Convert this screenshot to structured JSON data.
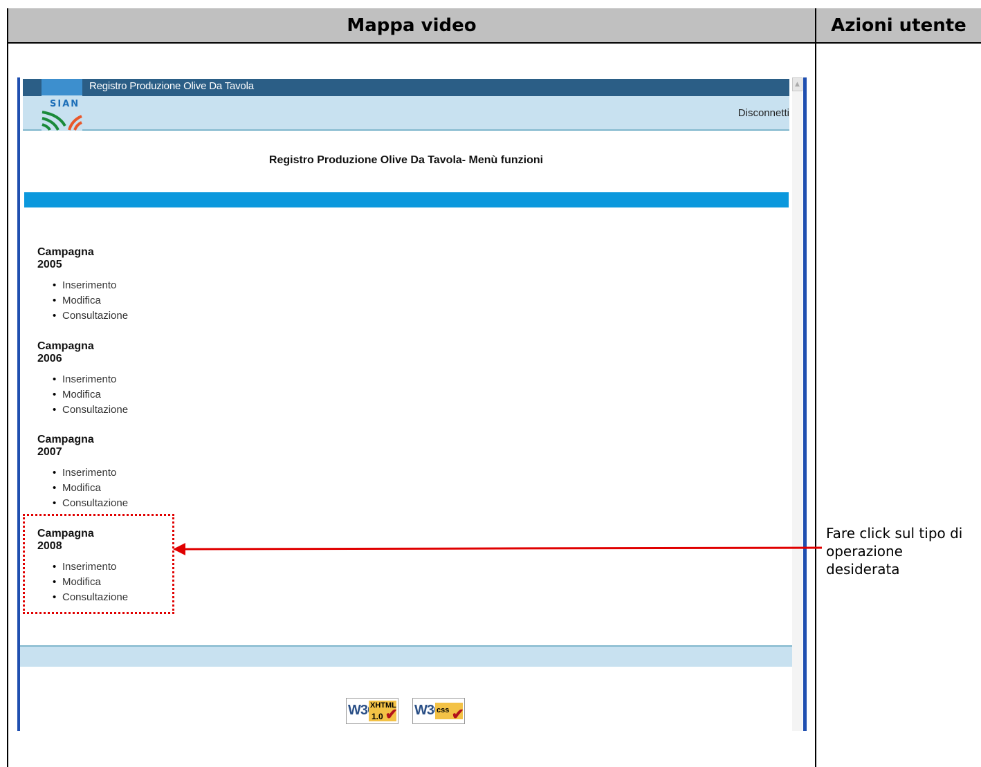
{
  "table": {
    "col_left_header": "Mappa video",
    "col_right_header": "Azioni utente"
  },
  "app": {
    "title": "Registro Produzione Olive Da Tavola",
    "logo_text": "SIAN",
    "logout_link": "Disconnetti",
    "page_heading": "Registro Produzione Olive Da Tavola- Menù funzioni"
  },
  "menu": {
    "campaigns": [
      {
        "title": "Campagna 2005",
        "items": [
          "Inserimento",
          "Modifica",
          "Consultazione"
        ]
      },
      {
        "title": "Campagna 2006",
        "items": [
          "Inserimento",
          "Modifica",
          "Consultazione"
        ]
      },
      {
        "title": "Campagna 2007",
        "items": [
          "Inserimento",
          "Modifica",
          "Consultazione"
        ]
      },
      {
        "title": "Campagna 2008",
        "items": [
          "Inserimento",
          "Modifica",
          "Consultazione"
        ]
      }
    ]
  },
  "badges": {
    "xhtml_brand": "W3C",
    "xhtml_label": "XHTML",
    "xhtml_version": "1.0",
    "css_brand": "W3C",
    "css_label": "css"
  },
  "annotation": {
    "note": "Fare click sul tipo di operazione desiderata",
    "highlight_color": "#e00000"
  },
  "colors": {
    "header_gray": "#c0c0c0",
    "app_dark_blue": "#2b5e86",
    "app_light_blue": "#c8e1f0",
    "app_stripe_blue": "#0b98dd",
    "frame_blue": "#1f4fb0"
  }
}
